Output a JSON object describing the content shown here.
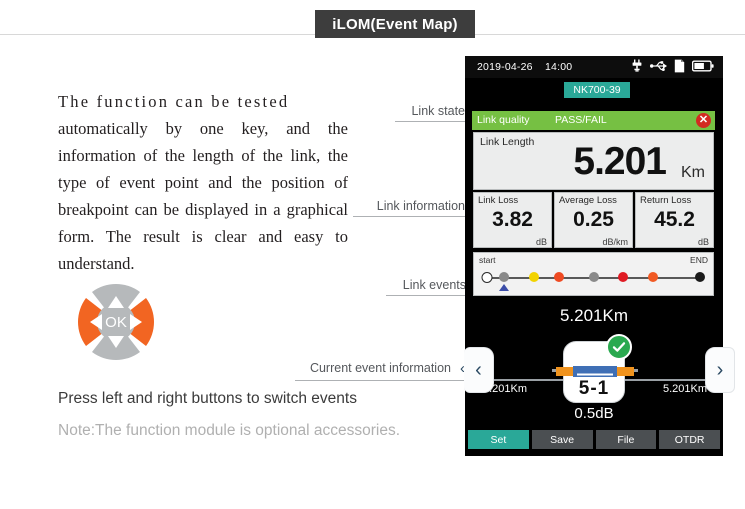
{
  "banner": {
    "title": "iLOM(Event Map)"
  },
  "description": {
    "line1": "The function can be tested",
    "rest": "automatically by one key, and the information of the length of the link, the type of event point and the position of breakpoint can be displayed in a graphical form. The result is clear and easy to understand."
  },
  "dpad": {
    "ok_label": "OK",
    "up_icon": "triangle-up-icon",
    "down_icon": "triangle-down-icon",
    "left_icon": "triangle-left-icon",
    "right_icon": "triangle-right-icon",
    "active_color": "#f26522",
    "idle_color": "#b6b9bb"
  },
  "notes": {
    "primary": "Press left and right buttons to switch events",
    "secondary": "Note:The function module is optional accessories."
  },
  "callouts": {
    "link_state": "Link state",
    "link_information": "Link information",
    "link_events": "Link events",
    "current_event_information": "Current event information",
    "current_event_chevron": "‹"
  },
  "device": {
    "statusbar": {
      "date": "2019-04-26",
      "time": "14:00",
      "icons": [
        "power-plug-icon",
        "usb-icon",
        "sd-card-icon",
        "battery-icon"
      ],
      "battery_level_pct": 55
    },
    "model_tab": "NK700-39",
    "link_quality": {
      "label": "Link quality",
      "result": "PASS/FAIL",
      "bar_color": "#76c043",
      "close_icon": "✕"
    },
    "link_length": {
      "label": "Link Length",
      "value": "5.201",
      "unit": "Km"
    },
    "metrics": [
      {
        "label": "Link Loss",
        "value": "3.82",
        "unit": "dB"
      },
      {
        "label": "Average Loss",
        "value": "0.25",
        "unit": "dB/km"
      },
      {
        "label": "Return Loss",
        "value": "45.2",
        "unit": "dB"
      }
    ],
    "events_track": {
      "start_label": "start",
      "end_label": "END",
      "cursor_position_pct": 8,
      "points": [
        {
          "pos_pct": 0,
          "color": "#ffffff",
          "type": "start-hollow"
        },
        {
          "pos_pct": 8,
          "color": "#8a8a8a",
          "type": "connector"
        },
        {
          "pos_pct": 22,
          "color": "#f2d300",
          "type": "event"
        },
        {
          "pos_pct": 34,
          "color": "#ef4a22",
          "type": "event"
        },
        {
          "pos_pct": 50,
          "color": "#8a8a8a",
          "type": "event"
        },
        {
          "pos_pct": 64,
          "color": "#e01b24",
          "type": "event"
        },
        {
          "pos_pct": 78,
          "color": "#f15a24",
          "type": "event"
        },
        {
          "pos_pct": 100,
          "color": "#1a1a1a",
          "type": "end"
        }
      ]
    },
    "distance_main": "5.201Km",
    "event_card": {
      "number": "5-1",
      "loss": "0.5dB",
      "status_icon": "check-circle-icon",
      "connector_icon": "fiber-connector-icon",
      "left_distance": "5.201Km",
      "right_distance": "5.201Km"
    },
    "nav": {
      "prev_icon": "‹",
      "next_icon": "›"
    },
    "soft_buttons": [
      {
        "label": "Set",
        "active": true
      },
      {
        "label": "Save",
        "active": false
      },
      {
        "label": "File",
        "active": false
      },
      {
        "label": "OTDR",
        "active": false
      }
    ]
  }
}
